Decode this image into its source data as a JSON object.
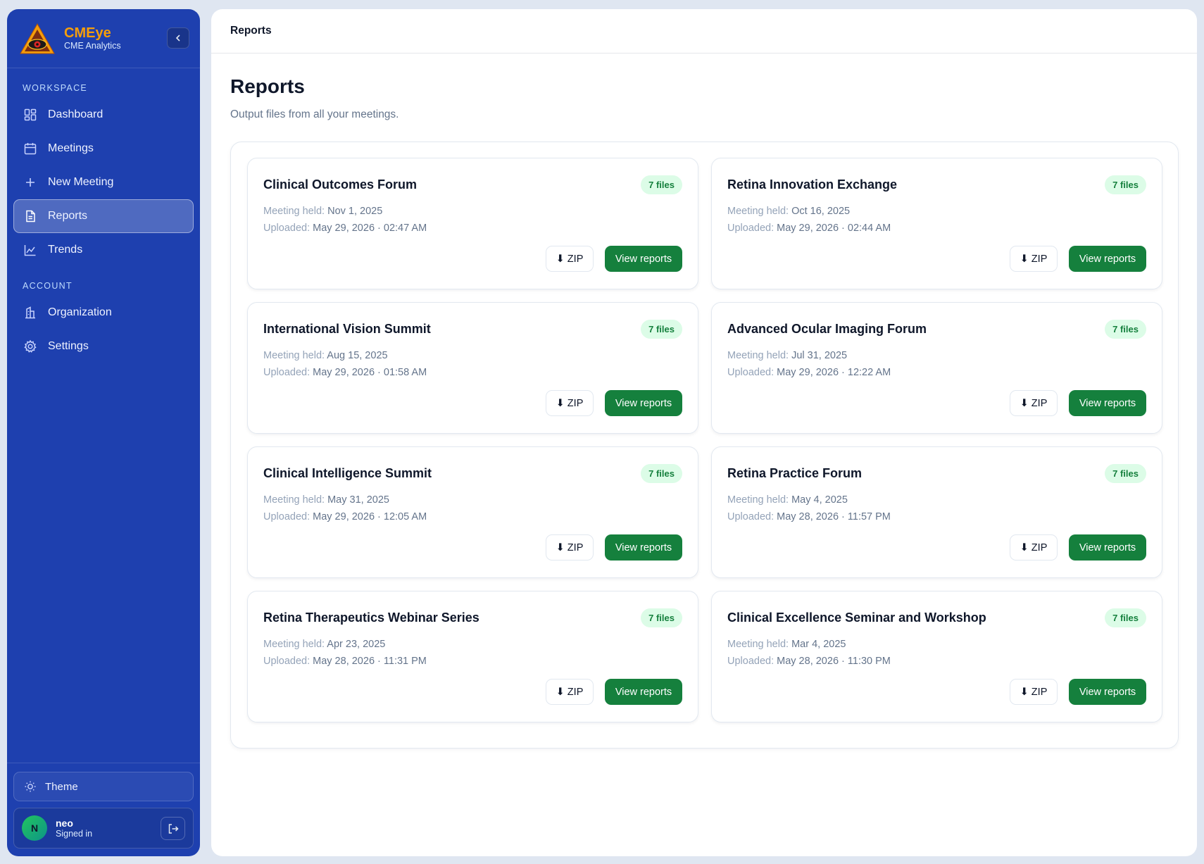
{
  "app": {
    "name": "CMEye",
    "subtitle": "CME Analytics"
  },
  "sidebar": {
    "workspace_label": "WORKSPACE",
    "account_label": "ACCOUNT",
    "workspace_items": [
      {
        "label": "Dashboard",
        "icon": "dashboard-icon"
      },
      {
        "label": "Meetings",
        "icon": "calendar-icon"
      },
      {
        "label": "New Meeting",
        "icon": "plus-icon"
      },
      {
        "label": "Reports",
        "icon": "document-icon",
        "active": true
      },
      {
        "label": "Trends",
        "icon": "chart-icon"
      }
    ],
    "account_items": [
      {
        "label": "Organization",
        "icon": "building-icon"
      },
      {
        "label": "Settings",
        "icon": "gear-icon"
      }
    ],
    "theme_label": "Theme",
    "user": {
      "initial": "N",
      "name": "neo",
      "status": "Signed in"
    }
  },
  "header": {
    "breadcrumb": "Reports"
  },
  "main": {
    "title": "Reports",
    "subtitle": "Output files from all your meetings.",
    "held_label": "Meeting held:",
    "uploaded_label": "Uploaded:",
    "zip_label": "⬇ ZIP",
    "view_label": "View reports",
    "cards": [
      {
        "title": "Clinical Outcomes Forum",
        "files": "7 files",
        "held": "Nov 1, 2025",
        "uploaded": "May 29, 2026 · 02:47 AM"
      },
      {
        "title": "Retina Innovation Exchange",
        "files": "7 files",
        "held": "Oct 16, 2025",
        "uploaded": "May 29, 2026 · 02:44 AM"
      },
      {
        "title": "International Vision Summit",
        "files": "7 files",
        "held": "Aug 15, 2025",
        "uploaded": "May 29, 2026 · 01:58 AM"
      },
      {
        "title": "Advanced Ocular Imaging Forum",
        "files": "7 files",
        "held": "Jul 31, 2025",
        "uploaded": "May 29, 2026 · 12:22 AM"
      },
      {
        "title": "Clinical Intelligence Summit",
        "files": "7 files",
        "held": "May 31, 2025",
        "uploaded": "May 29, 2026 · 12:05 AM"
      },
      {
        "title": "Retina Practice Forum",
        "files": "7 files",
        "held": "May 4, 2025",
        "uploaded": "May 28, 2026 · 11:57 PM"
      },
      {
        "title": "Retina Therapeutics Webinar Series",
        "files": "7 files",
        "held": "Apr 23, 2025",
        "uploaded": "May 28, 2026 · 11:31 PM"
      },
      {
        "title": "Clinical Excellence Seminar and Workshop",
        "files": "7 files",
        "held": "Mar 4, 2025",
        "uploaded": "May 28, 2026 · 11:30 PM"
      }
    ]
  },
  "colors": {
    "sidebar_bg": "#1e40af",
    "brand_accent": "#f59e0b",
    "primary_green": "#15803d",
    "badge_bg": "#dcfce7"
  }
}
